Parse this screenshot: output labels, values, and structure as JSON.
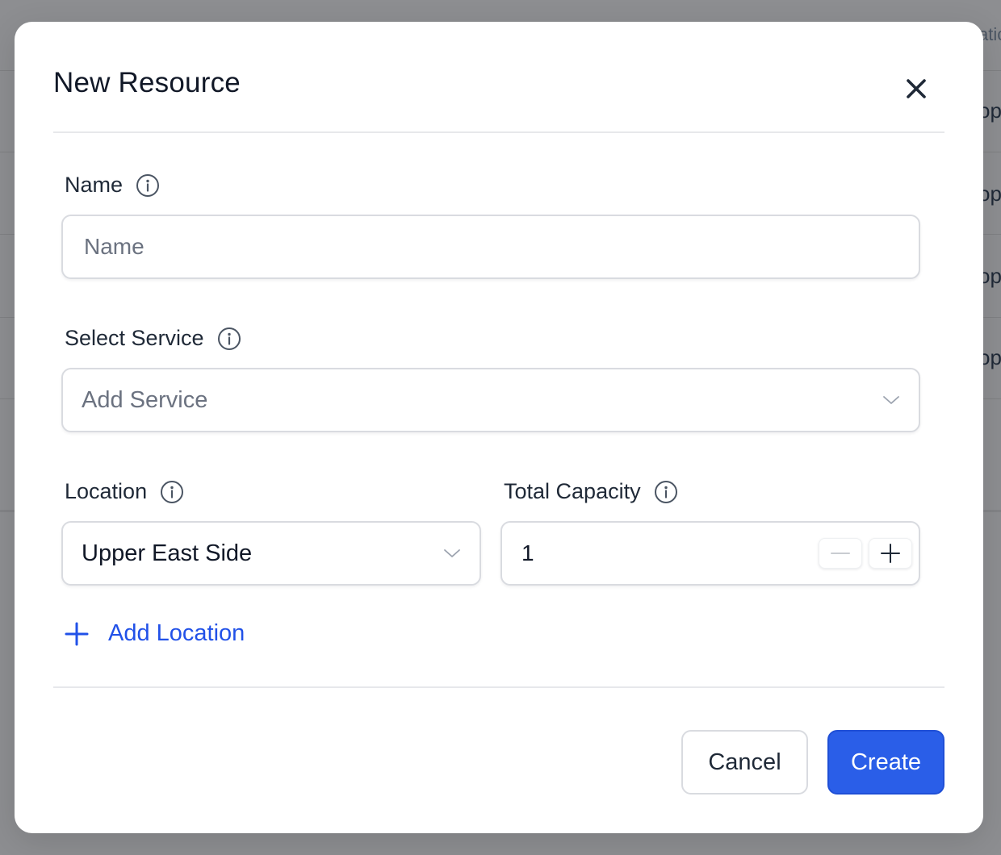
{
  "background": {
    "column_header_partial": "atic",
    "row_texts_partial": [
      "op",
      "op",
      "op",
      "op"
    ]
  },
  "modal": {
    "title": "New Resource",
    "close_icon": "close-icon"
  },
  "form": {
    "name": {
      "label": "Name",
      "placeholder": "Name",
      "value": ""
    },
    "service": {
      "label": "Select Service",
      "placeholder": "Add Service"
    },
    "location": {
      "label": "Location",
      "value": "Upper East Side"
    },
    "capacity": {
      "label": "Total Capacity",
      "value": "1"
    },
    "add_location_label": "Add Location"
  },
  "actions": {
    "cancel_label": "Cancel",
    "create_label": "Create"
  },
  "colors": {
    "accent": "#2a5ee8",
    "link": "#2151e8",
    "overlay": "#8d8e91"
  }
}
